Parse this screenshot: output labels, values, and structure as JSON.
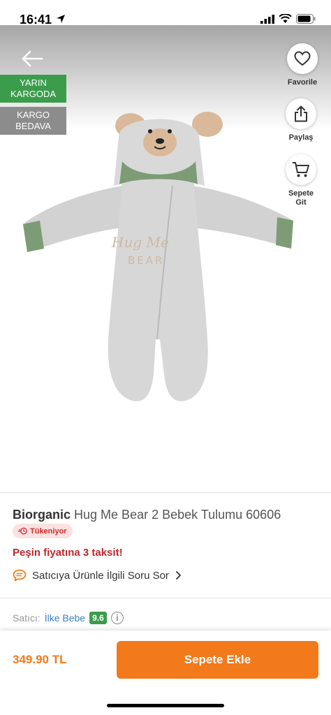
{
  "status": {
    "time": "16:41"
  },
  "hero": {
    "ribbon_1": [
      "YARIN",
      "KARGODA"
    ],
    "ribbon_2": [
      "KARGO",
      "BEDAVA"
    ],
    "actions": {
      "favorite": "Favorile",
      "share": "Paylaş",
      "cart_line1": "Sepete",
      "cart_line2": "Git"
    },
    "garment_text_1": "Hug Me",
    "garment_text_2": "BEAR"
  },
  "product": {
    "brand": "Biorganic",
    "name": "Hug Me Bear 2 Bebek Tulumu 60606",
    "stock_badge": "Tükeniyor",
    "installment": "Peşin fiyatına 3 taksit!",
    "ask_seller": "Satıcıya Ürünle İlgili Soru Sor"
  },
  "seller": {
    "label": "Satıcı:",
    "name": "İlke Bebe",
    "score": "9.6"
  },
  "bottom": {
    "price": "349.90 TL",
    "add_to_cart": "Sepete Ekle"
  },
  "colors": {
    "accent": "#f27a1a",
    "green": "#3b9c4b",
    "red": "#c1272d",
    "link": "#3b82c4"
  }
}
